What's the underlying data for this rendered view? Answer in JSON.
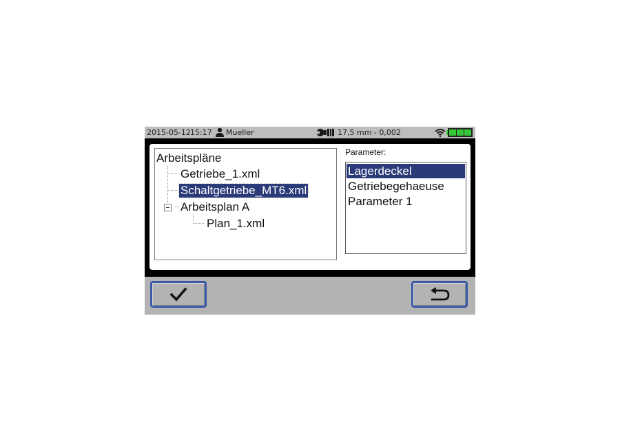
{
  "status_bar": {
    "date": "2015-05-12",
    "time": "15:17",
    "user": "Mueller",
    "measurement": "17,5 mm - 0,002",
    "icons": [
      "user-icon",
      "tool-icon",
      "wifi-icon",
      "battery-icon"
    ],
    "battery_color": "#37c837"
  },
  "tree": {
    "root": "Arbeitspläne",
    "items": [
      {
        "label": "Getriebe_1.xml"
      },
      {
        "label": "Schaltgetriebe_MT6.xml",
        "selected": true
      },
      {
        "label": "Arbeitsplan A"
      },
      {
        "label": "Plan_1.xml"
      }
    ]
  },
  "parameter": {
    "label": "Parameter:",
    "items": [
      {
        "label": "Lagerdeckel",
        "selected": true
      },
      {
        "label": "Getriebegehaeuse"
      },
      {
        "label": "Parameter 1"
      }
    ]
  },
  "buttons": {
    "ok_icon": "checkmark-icon",
    "back_icon": "back-arrow-icon"
  },
  "colors": {
    "selection": "#2b3a79",
    "button_border": "#3a5aa8",
    "status_bar_bg": "#bdbdbd"
  }
}
